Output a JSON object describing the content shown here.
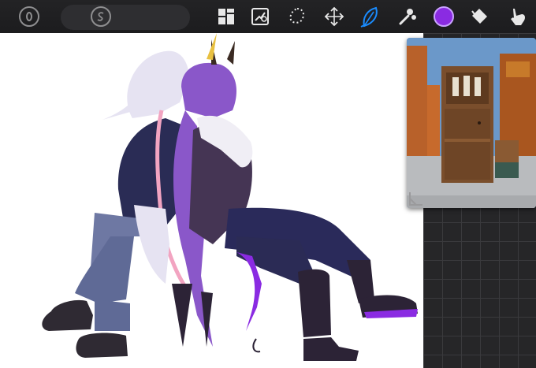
{
  "toolbar": {
    "tools": [
      {
        "name": "gallery",
        "icon": "grid-icon",
        "active": false
      },
      {
        "name": "adjustments",
        "icon": "adjust-icon",
        "active": false
      },
      {
        "name": "selection",
        "icon": "lasso-icon",
        "active": false
      },
      {
        "name": "transform",
        "icon": "move-arrows-icon",
        "active": false
      },
      {
        "name": "brush",
        "icon": "leaf-brush-icon",
        "active": true
      },
      {
        "name": "smudge",
        "icon": "smudge-icon",
        "active": false
      },
      {
        "name": "color",
        "icon": "color-swatch-icon",
        "active": false
      },
      {
        "name": "fill",
        "icon": "paint-bucket-icon",
        "active": false
      },
      {
        "name": "finger",
        "icon": "finger-icon",
        "active": false
      }
    ],
    "accent_color": "#1a8cff",
    "current_color": "#8a2be2"
  },
  "left_buttons": [
    {
      "icon": "o-symbol-icon"
    },
    {
      "icon": "s-symbol-icon"
    }
  ],
  "canvas": {
    "background": "#ffffff",
    "content": "character-illustration"
  },
  "reference_window": {
    "content": "door-reference-photo",
    "sky_color": "#6b98c9"
  }
}
